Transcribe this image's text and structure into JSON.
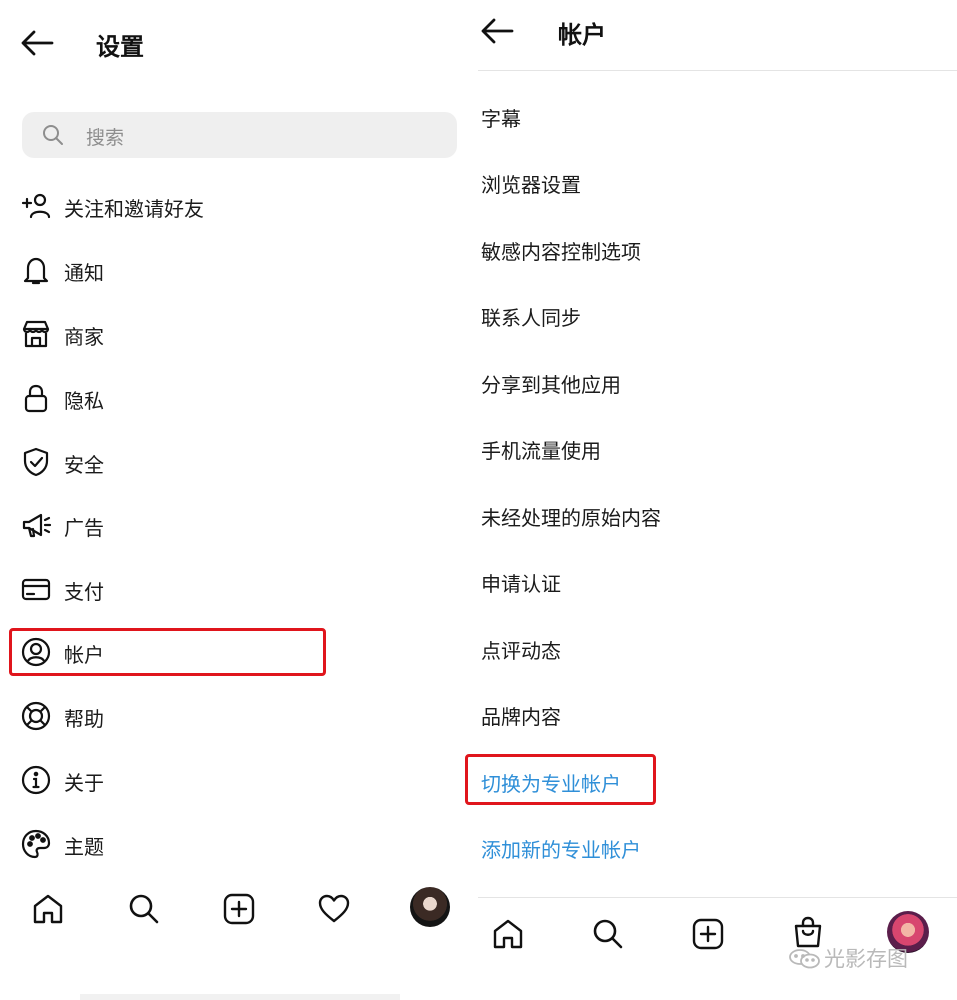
{
  "left": {
    "header": {
      "title": "设置"
    },
    "search": {
      "placeholder": "搜索"
    },
    "menu": [
      {
        "label": "关注和邀请好友",
        "icon": "add-person-icon"
      },
      {
        "label": "通知",
        "icon": "bell-icon"
      },
      {
        "label": "商家",
        "icon": "store-icon"
      },
      {
        "label": "隐私",
        "icon": "lock-icon"
      },
      {
        "label": "安全",
        "icon": "shield-icon"
      },
      {
        "label": "广告",
        "icon": "megaphone-icon"
      },
      {
        "label": "支付",
        "icon": "credit-card-icon"
      },
      {
        "label": "帐户",
        "icon": "account-icon",
        "highlighted": true
      },
      {
        "label": "帮助",
        "icon": "lifebuoy-icon"
      },
      {
        "label": "关于",
        "icon": "info-icon"
      },
      {
        "label": "主题",
        "icon": "palette-icon"
      }
    ],
    "bottom_nav": [
      "home-icon",
      "search-icon",
      "create-post-icon",
      "heart-icon",
      "profile-avatar"
    ]
  },
  "right": {
    "header": {
      "title": "帐户"
    },
    "items": [
      {
        "label": "字幕"
      },
      {
        "label": "浏览器设置"
      },
      {
        "label": "敏感内容控制选项"
      },
      {
        "label": "联系人同步"
      },
      {
        "label": "分享到其他应用"
      },
      {
        "label": "手机流量使用"
      },
      {
        "label": "未经处理的原始内容"
      },
      {
        "label": "申请认证"
      },
      {
        "label": "点评动态"
      },
      {
        "label": "品牌内容"
      }
    ],
    "links": [
      {
        "label": "切换为专业帐户",
        "highlighted": true
      },
      {
        "label": "添加新的专业帐户"
      }
    ],
    "bottom_nav": [
      "home-icon",
      "search-icon",
      "create-post-icon",
      "shop-bag-icon",
      "profile-avatar"
    ]
  },
  "watermark": {
    "text": "光影存图"
  },
  "colors": {
    "highlight": "#e0151c",
    "link": "#2f8fd8",
    "search_bg": "#efefef",
    "text": "#1b1b1b"
  }
}
